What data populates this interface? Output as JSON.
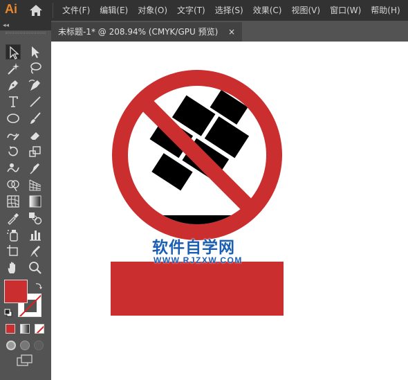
{
  "app": {
    "logo": "Ai",
    "menus": [
      "文件(F)",
      "编辑(E)",
      "对象(O)",
      "文字(T)",
      "选择(S)",
      "效果(C)",
      "视图(V)",
      "窗口(W)",
      "帮助(H)"
    ]
  },
  "document": {
    "tab_title": "未标题-1* @ 208.94% (CMYK/GPU 预览)",
    "close_label": "×"
  },
  "toolbar": {
    "collapse_label": "◂◂",
    "tools": [
      "selection-tool",
      "direct-selection-tool",
      "magic-wand-tool",
      "lasso-tool",
      "pen-tool",
      "curvature-tool",
      "type-tool",
      "line-segment-tool",
      "ellipse-tool",
      "paintbrush-tool",
      "shaper-tool",
      "eraser-tool",
      "rotate-tool",
      "scale-tool",
      "warp-tool",
      "free-transform-tool",
      "shape-builder-tool",
      "perspective-grid-tool",
      "mesh-tool",
      "gradient-tool",
      "eyedropper-tool",
      "blend-tool",
      "symbol-sprayer-tool",
      "column-graph-tool",
      "artboard-tool",
      "slice-tool",
      "hand-tool",
      "zoom-tool"
    ],
    "fill_color": "#cb2e2e",
    "stroke_color": "none"
  },
  "canvas": {
    "sign_color": "#cb2e2e",
    "brick_color": "#000000",
    "watermark_cn": "软件自学网",
    "watermark_url": "WWW.RJZXW.COM"
  }
}
